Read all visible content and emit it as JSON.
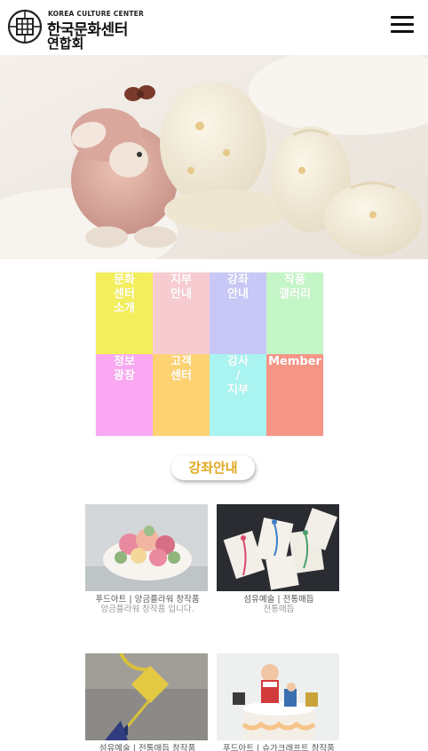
{
  "header": {
    "logo_en": "KOREA CULTURE CENTER",
    "logo_ko_line1": "한국문화센터",
    "logo_ko_line2": "연합회",
    "menu_icon": "hamburger-menu-icon"
  },
  "hero": {
    "image": "baby-clothes-and-plush-toy-photo"
  },
  "grid": {
    "items": [
      {
        "label": "문화\n센터\n소개",
        "color": "#f3ef5c"
      },
      {
        "label": "지부\n안내",
        "color": "#f7ccd1"
      },
      {
        "label": "강좌\n안내",
        "color": "#c8c8f6"
      },
      {
        "label": "작품\n갤러리",
        "color": "#c4f5c7"
      },
      {
        "label": "정보\n광장",
        "color": "#f9a8f1"
      },
      {
        "label": "고객\n센터",
        "color": "#fdd272"
      },
      {
        "label": "강사\n/\n지부",
        "color": "#a9f4f1"
      },
      {
        "label": "Member",
        "color": "#f59585"
      }
    ]
  },
  "section": {
    "title": "강좌안내",
    "accent": "#e0a820"
  },
  "products": [
    {
      "category": "푸드아트 | 앙금플라워 창작품",
      "desc": "앙금플라워 창작품 입니다.",
      "image": "flower-cake-photo"
    },
    {
      "category": "섬유예술 | 전통매듭",
      "desc": "전통매듭",
      "image": "knot-bookmarks-photo"
    },
    {
      "category": "섬유예술 | 전통매듭 창작품",
      "desc": "",
      "image": "knot-tassel-photo"
    },
    {
      "category": "푸드아트 | 슈가크래프트 창작품",
      "desc": "",
      "image": "sugarcraft-cake-photo"
    }
  ]
}
